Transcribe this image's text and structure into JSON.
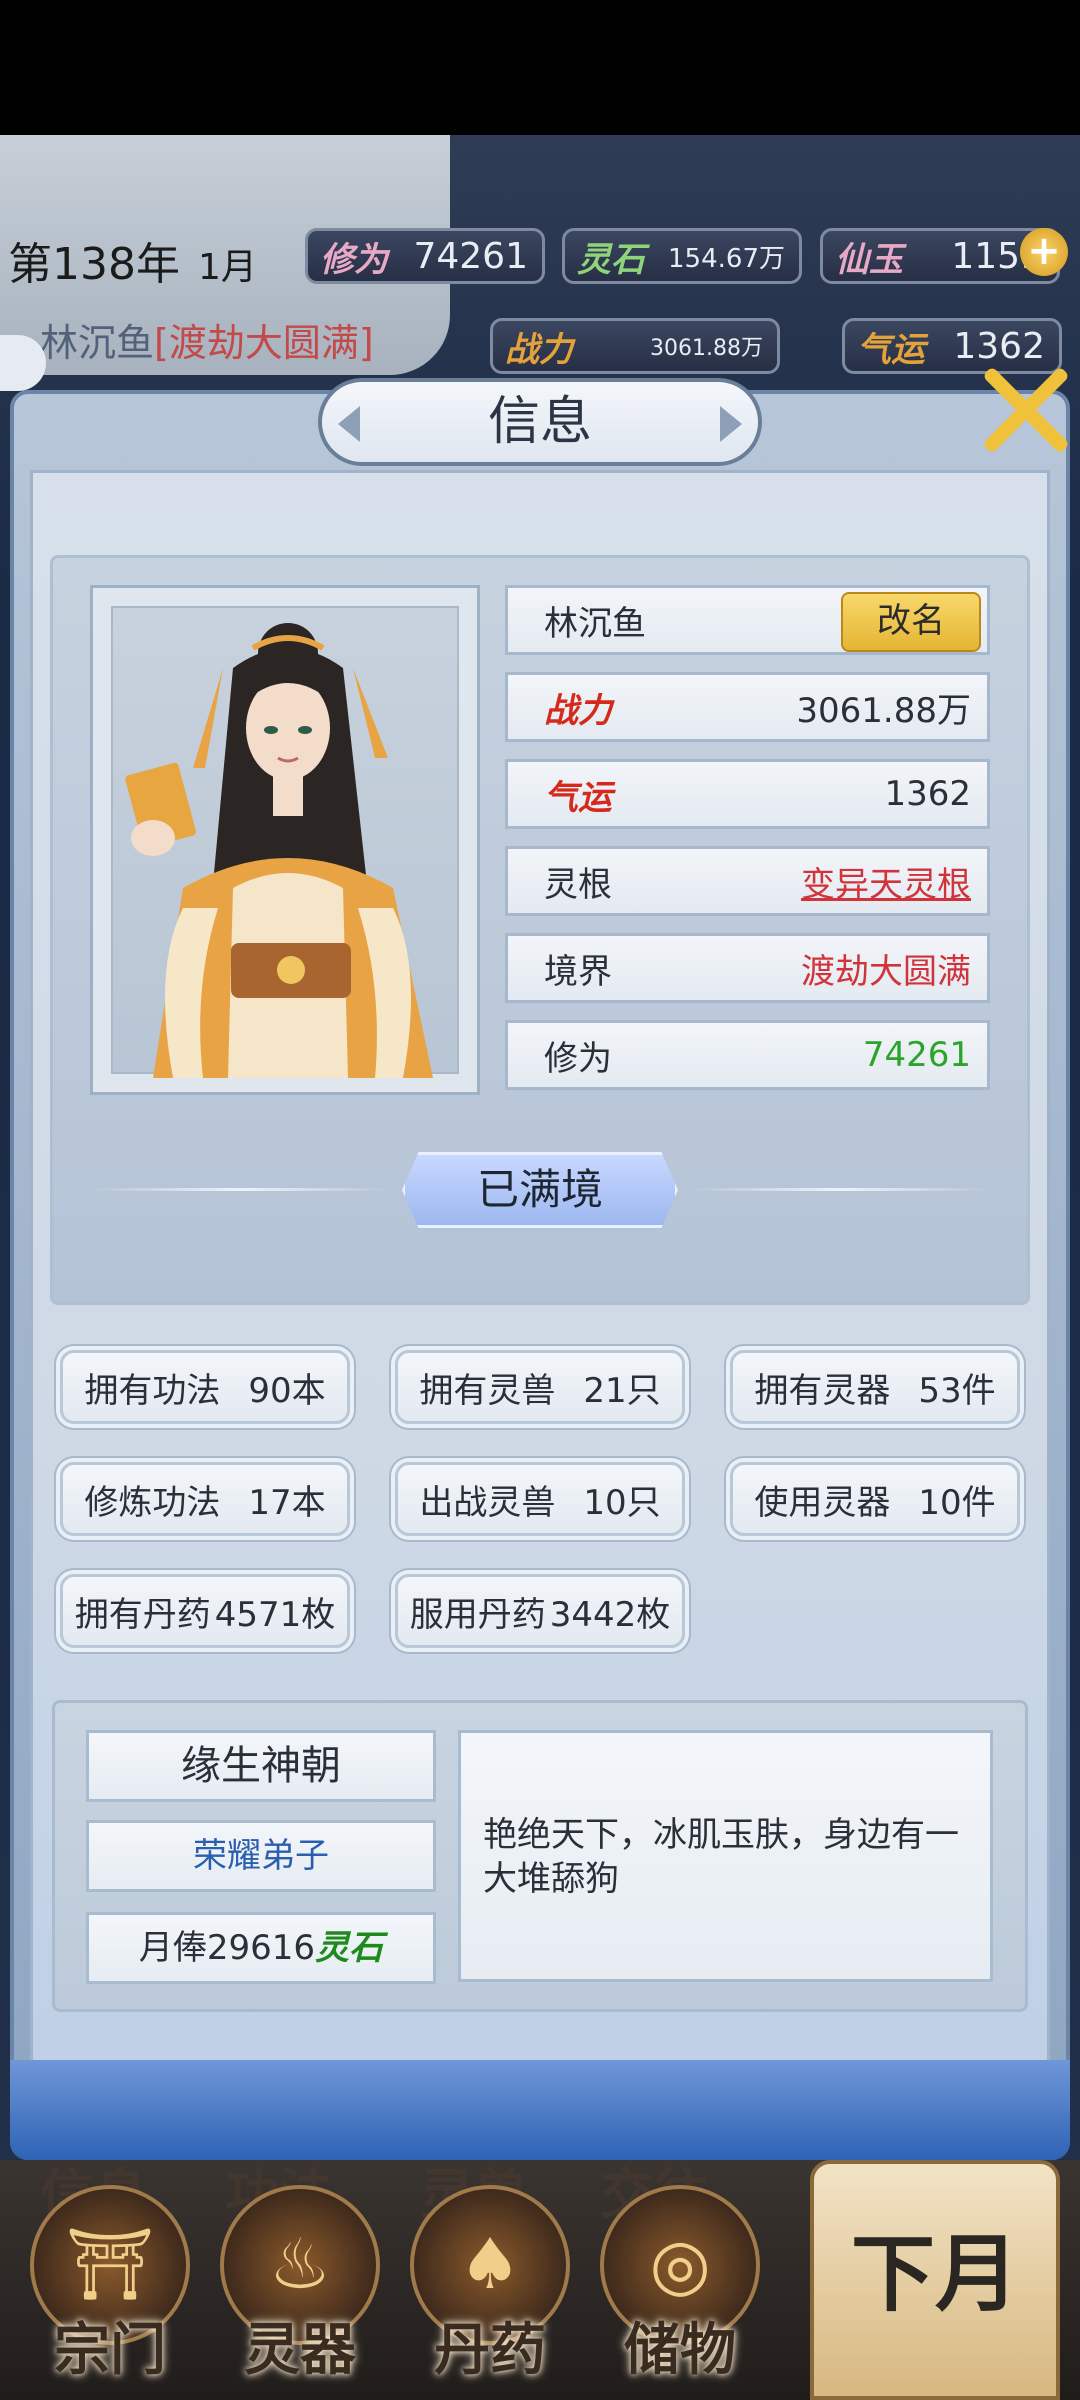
{
  "header": {
    "year": "第138年",
    "month": "1月",
    "cultivation_label": "修为",
    "cultivation_value": "74261",
    "spirit_stone_label": "灵石",
    "spirit_stone_value": "154.67万",
    "jade_label": "仙玉",
    "jade_value": "1159",
    "power_label": "战力",
    "power_value": "3061.88万",
    "luck_label": "气运",
    "luck_value": "1362",
    "player_name": "林沉鱼",
    "player_realm": "[渡劫大圆满]"
  },
  "dialog": {
    "title": "信息",
    "attributes": {
      "name": "林沉鱼",
      "rename_button": "改名",
      "power_label": "战力",
      "power_value": "3061.88万",
      "luck_label": "气运",
      "luck_value": "1362",
      "root_label": "灵根",
      "root_value": "变异天灵根",
      "realm_label": "境界",
      "realm_value": "渡劫大圆满",
      "cultivation_label": "修为",
      "cultivation_value": "74261"
    },
    "full_realm_banner": "已满境",
    "stats": [
      {
        "label": "拥有功法",
        "value": "90本"
      },
      {
        "label": "拥有灵兽",
        "value": "21只"
      },
      {
        "label": "拥有灵器",
        "value": "53件"
      },
      {
        "label": "修炼功法",
        "value": "17本"
      },
      {
        "label": "出战灵兽",
        "value": "10只"
      },
      {
        "label": "使用灵器",
        "value": "10件"
      },
      {
        "label": "拥有丹药",
        "value": "4571枚"
      },
      {
        "label": "服用丹药",
        "value": "3442枚"
      }
    ],
    "sect": {
      "name": "缘生神朝",
      "rank": "荣耀弟子",
      "salary_prefix": "月俸29616",
      "salary_unit": "灵石",
      "description": "艳绝天下，冰肌玉肤，身边有一大堆舔狗"
    }
  },
  "bottom_nav": {
    "ghost_labels": [
      "信息",
      "功法",
      "灵兽",
      "交往"
    ],
    "items": [
      {
        "label": "宗门",
        "icon": "sect-gate-icon"
      },
      {
        "label": "灵器",
        "icon": "flame-artifact-icon"
      },
      {
        "label": "丹药",
        "icon": "gourd-icon"
      },
      {
        "label": "储物",
        "icon": "ring-icon"
      }
    ],
    "next_month": "下月"
  },
  "colors": {
    "accent_gold": "#f0c13a",
    "realm_red": "#c24a4a",
    "cultivation_green": "#2aa52a",
    "rank_blue": "#2a5fb0"
  }
}
